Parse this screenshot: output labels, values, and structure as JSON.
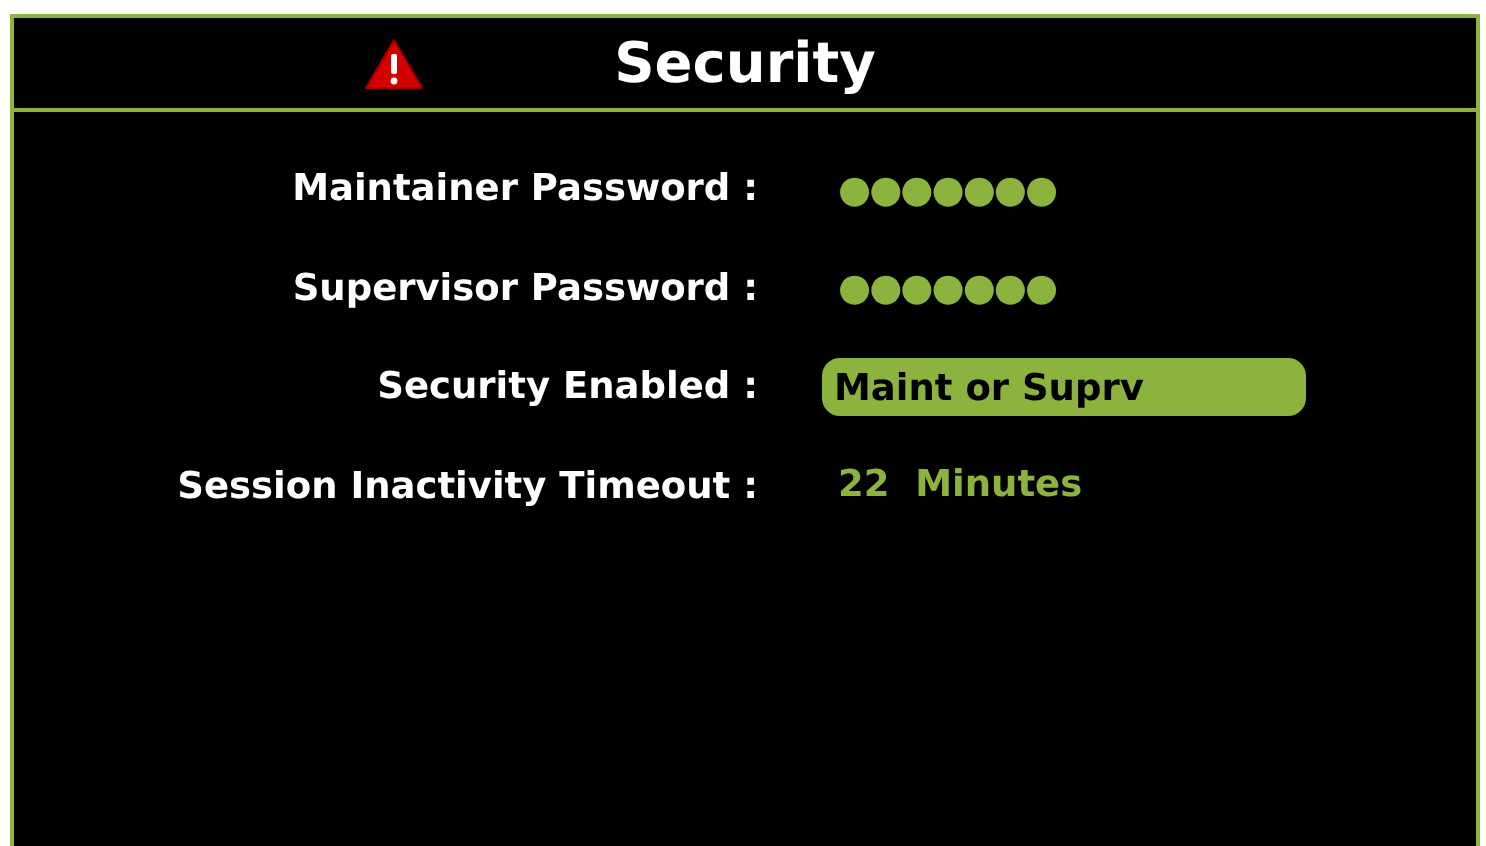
{
  "header": {
    "title": "Security"
  },
  "rows": [
    {
      "label": "Maintainer Password :",
      "kind": "password",
      "value": "●●●●●●●"
    },
    {
      "label": "Supervisor Password :",
      "kind": "password",
      "value": "●●●●●●●"
    },
    {
      "label": "Security Enabled :",
      "kind": "select",
      "value": "Maint or Suprv"
    },
    {
      "label": "Session Inactivity Timeout :",
      "kind": "text",
      "value": "22  Minutes"
    }
  ]
}
